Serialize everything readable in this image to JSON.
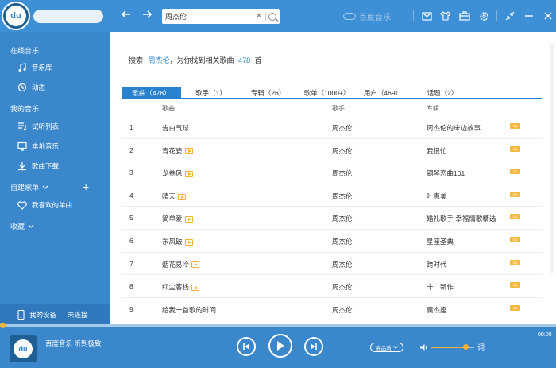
{
  "topbar": {
    "logo_text": "du",
    "back_icon": "arrow-left-icon",
    "forward_icon": "arrow-right-icon",
    "search_query": "周杰伦",
    "brand_name": "百度音乐",
    "icons": [
      "mail-icon",
      "shirt-icon",
      "toolbox-icon",
      "gear-icon",
      "shrink-icon",
      "minimize-icon",
      "close-icon"
    ]
  },
  "sidebar": {
    "online_music": "在线音乐",
    "music_library": "音乐库",
    "feed": "动态",
    "my_music": "我的音乐",
    "trial_list": "试听列表",
    "local_music": "本地音乐",
    "downloads": "歌曲下载",
    "custom_playlists": "自建歌单",
    "favorite_songs": "我喜欢的单曲",
    "favorites": "收藏",
    "my_device": "我的设备",
    "device_status": "未连接"
  },
  "results": {
    "prefix": "搜索",
    "keyword": "周杰伦",
    "middle": "，为你找到相关歌曲",
    "count": "478",
    "suffix": "首"
  },
  "tabs": [
    {
      "label": "歌曲（478）",
      "active": true
    },
    {
      "label": "歌手（1）",
      "active": false
    },
    {
      "label": "专辑（26）",
      "active": false
    },
    {
      "label": "歌单（1000+）",
      "active": false
    },
    {
      "label": "用户（469）",
      "active": false
    },
    {
      "label": "话题（2）",
      "active": false
    }
  ],
  "columns": {
    "song": "歌曲",
    "artist": "歌手",
    "album": "专辑"
  },
  "songs": [
    {
      "num": "1",
      "title": "告白气球",
      "mv": false,
      "artist": "周杰伦",
      "album": "周杰伦的床边故事"
    },
    {
      "num": "2",
      "title": "青花瓷",
      "mv": true,
      "artist": "周杰伦",
      "album": "我很忙"
    },
    {
      "num": "3",
      "title": "龙卷风",
      "mv": true,
      "artist": "周杰伦",
      "album": "钢琴恋曲101"
    },
    {
      "num": "4",
      "title": "晴天",
      "mv": true,
      "artist": "周杰伦",
      "album": "叶惠美"
    },
    {
      "num": "5",
      "title": "简单爱",
      "mv": true,
      "artist": "周杰伦",
      "album": "婚礼歌手 幸福情歌精选"
    },
    {
      "num": "6",
      "title": "东风破",
      "mv": true,
      "artist": "周杰伦",
      "album": "星座圣典"
    },
    {
      "num": "7",
      "title": "烟花易冷",
      "mv": true,
      "artist": "周杰伦",
      "album": "跨时代"
    },
    {
      "num": "8",
      "title": "红尘客栈",
      "mv": true,
      "artist": "周杰伦",
      "album": "十二新作"
    },
    {
      "num": "9",
      "title": "给我一首歌的时间",
      "mv": false,
      "artist": "周杰伦",
      "album": "魔杰座"
    }
  ],
  "quality_badge": "SQ",
  "player": {
    "cover_text": "du",
    "now_playing": "百度音乐 听到极致",
    "quality": "高品质",
    "lyric": "词",
    "time": "00:00",
    "volume_fraction": 0.8
  }
}
